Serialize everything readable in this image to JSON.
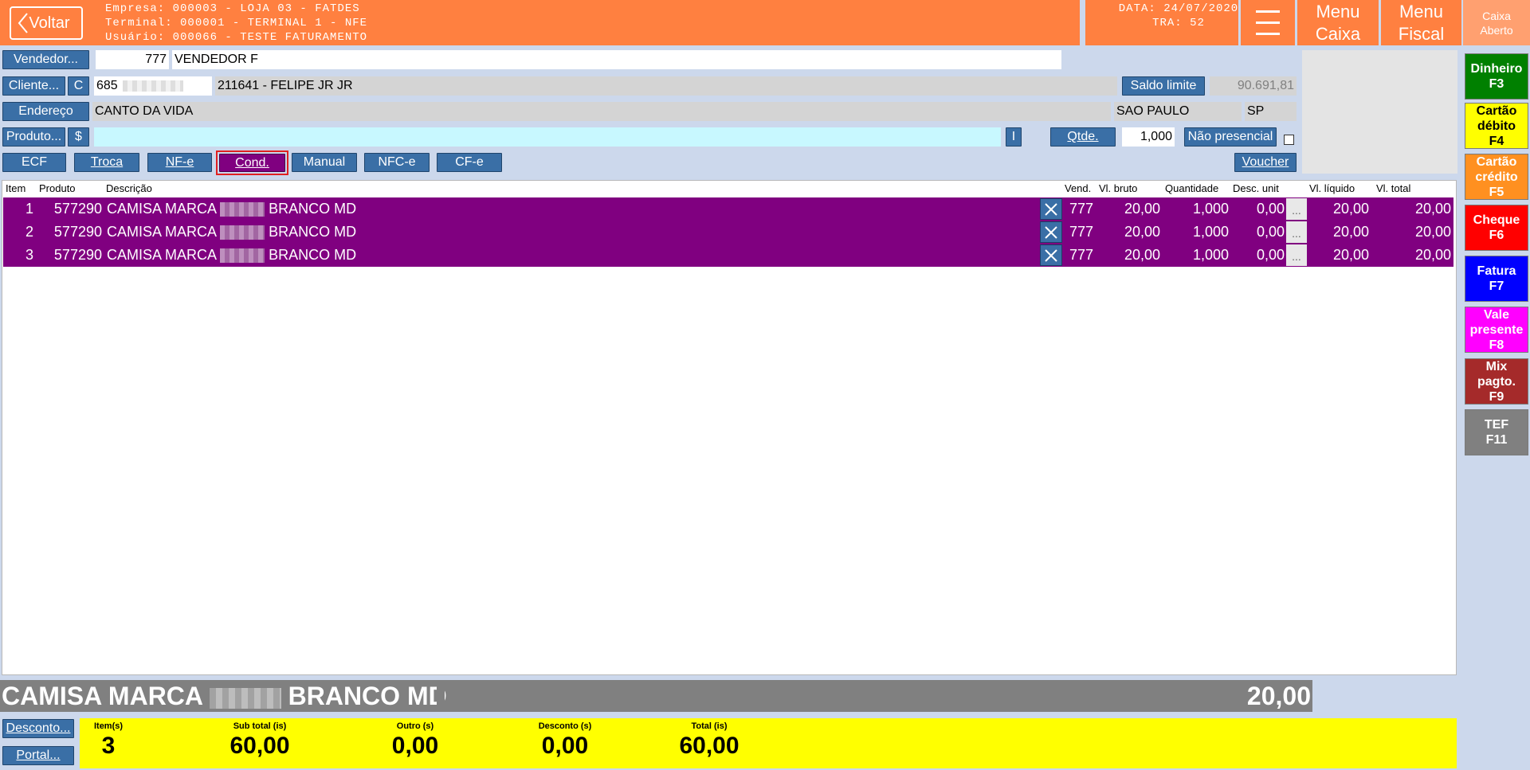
{
  "header": {
    "back_label": "Voltar",
    "empresa": "Empresa: 000003 - LOJA 03 - FATDES",
    "terminal": "Terminal: 000001 - TERMINAL 1 - NFE",
    "usuario": "Usuário: 000066 - TESTE FATURAMENTO",
    "data": "DATA: 24/07/2020",
    "tra": "TRA: 52",
    "menu_caixa_1": "Menu",
    "menu_caixa_2": "Caixa",
    "menu_fiscal_1": "Menu",
    "menu_fiscal_2": "Fiscal",
    "caixa_status_1": "Caixa",
    "caixa_status_2": "Aberto"
  },
  "form": {
    "vendedor_btn": "Vendedor...",
    "vendedor_code": "777",
    "vendedor_name": "VENDEDOR F",
    "cliente_btn": "Cliente...",
    "cliente_c": "C",
    "cliente_code": "685",
    "cliente_name": "211641 - FELIPE JR JR",
    "saldo_btn": "Saldo limite",
    "saldo_value": "90.691,81",
    "endereco_btn": "Endereço",
    "endereco_value": "CANTO DA VIDA",
    "cidade": "SAO PAULO",
    "uf": "SP",
    "produto_btn": "Produto...",
    "produto_dollar": "$",
    "produto_value": "",
    "i_btn": "I",
    "qtde_btn": "Qtde.",
    "qtde_value": "1,000",
    "nao_presencial": "Não presencial",
    "voucher": "Voucher"
  },
  "mode_tabs": [
    "ECF",
    "Troca",
    "NF-e",
    "Cond.",
    "Manual",
    "NFC-e",
    "CF-e"
  ],
  "grid": {
    "headers": {
      "item": "Item",
      "produto": "Produto",
      "descricao": "Descrição",
      "vend": "Vend.",
      "vl_bruto": "Vl. bruto",
      "quantidade": "Quantidade",
      "desc_unit": "Desc. unit",
      "vl_liquido": "Vl. líquido",
      "vl_total": "Vl. total"
    },
    "rows": [
      {
        "item": "1",
        "produto": "577290",
        "desc_a": "CAMISA MARCA",
        "desc_b": "BRANCO MD",
        "vend": "777",
        "vl_bruto": "20,00",
        "quantidade": "1,000",
        "desc_unit": "0,00",
        "dots": "...",
        "vl_liquido": "20,00",
        "vl_total": "20,00"
      },
      {
        "item": "2",
        "produto": "577290",
        "desc_a": "CAMISA MARCA",
        "desc_b": "BRANCO MD",
        "vend": "777",
        "vl_bruto": "20,00",
        "quantidade": "1,000",
        "desc_unit": "0,00",
        "dots": "...",
        "vl_liquido": "20,00",
        "vl_total": "20,00"
      },
      {
        "item": "3",
        "produto": "577290",
        "desc_a": "CAMISA MARCA",
        "desc_b": "BRANCO MD",
        "vend": "777",
        "vl_bruto": "20,00",
        "quantidade": "1,000",
        "desc_unit": "0,00",
        "dots": "...",
        "vl_liquido": "20,00",
        "vl_total": "20,00"
      }
    ]
  },
  "current_item": {
    "desc_a": "CAMISA MARCA",
    "desc_b": "BRANCO MD",
    "value": "20,00"
  },
  "footer": {
    "desconto_btn": "Desconto...",
    "portal_btn": "Portal...",
    "itens_label": "Item(s)",
    "itens_value": "3",
    "subtotal_label": "Sub total (is)",
    "subtotal_value": "60,00",
    "outro_label": "Outro (s)",
    "outro_value": "0,00",
    "desconto_label": "Desconto (s)",
    "desconto_value": "0,00",
    "total_label": "Total (is)",
    "total_value": "60,00"
  },
  "payments": [
    {
      "l1": "Dinheiro",
      "l2": "F3",
      "bg": "#008000",
      "fg": "#ffffff"
    },
    {
      "l1": "Cartão",
      "l2": "débito",
      "l3": "F4",
      "bg": "#ffff00",
      "fg": "#000000"
    },
    {
      "l1": "Cartão",
      "l2": "crédito",
      "l3": "F5",
      "bg": "#ff9020",
      "fg": "#ffffff"
    },
    {
      "l1": "Cheque",
      "l2": "F6",
      "bg": "#ff0000",
      "fg": "#ffffff"
    },
    {
      "l1": "Fatura",
      "l2": "F7",
      "bg": "#0000ff",
      "fg": "#ffffff"
    },
    {
      "l1": "Vale",
      "l2": "presente",
      "l3": "F8",
      "bg": "#ff00ff",
      "fg": "#ffffff"
    },
    {
      "l1": "Mix",
      "l2": "pagto.",
      "l3": "F9",
      "bg": "#a52a2a",
      "fg": "#ffffff"
    },
    {
      "l1": "TEF",
      "l2": "F11",
      "bg": "#808080",
      "fg": "#ffffff"
    }
  ],
  "colors": {
    "header": "#ff8040",
    "row_selected": "#800080",
    "button_blue": "#3a6fa6",
    "totals_bg": "#ffff00"
  }
}
